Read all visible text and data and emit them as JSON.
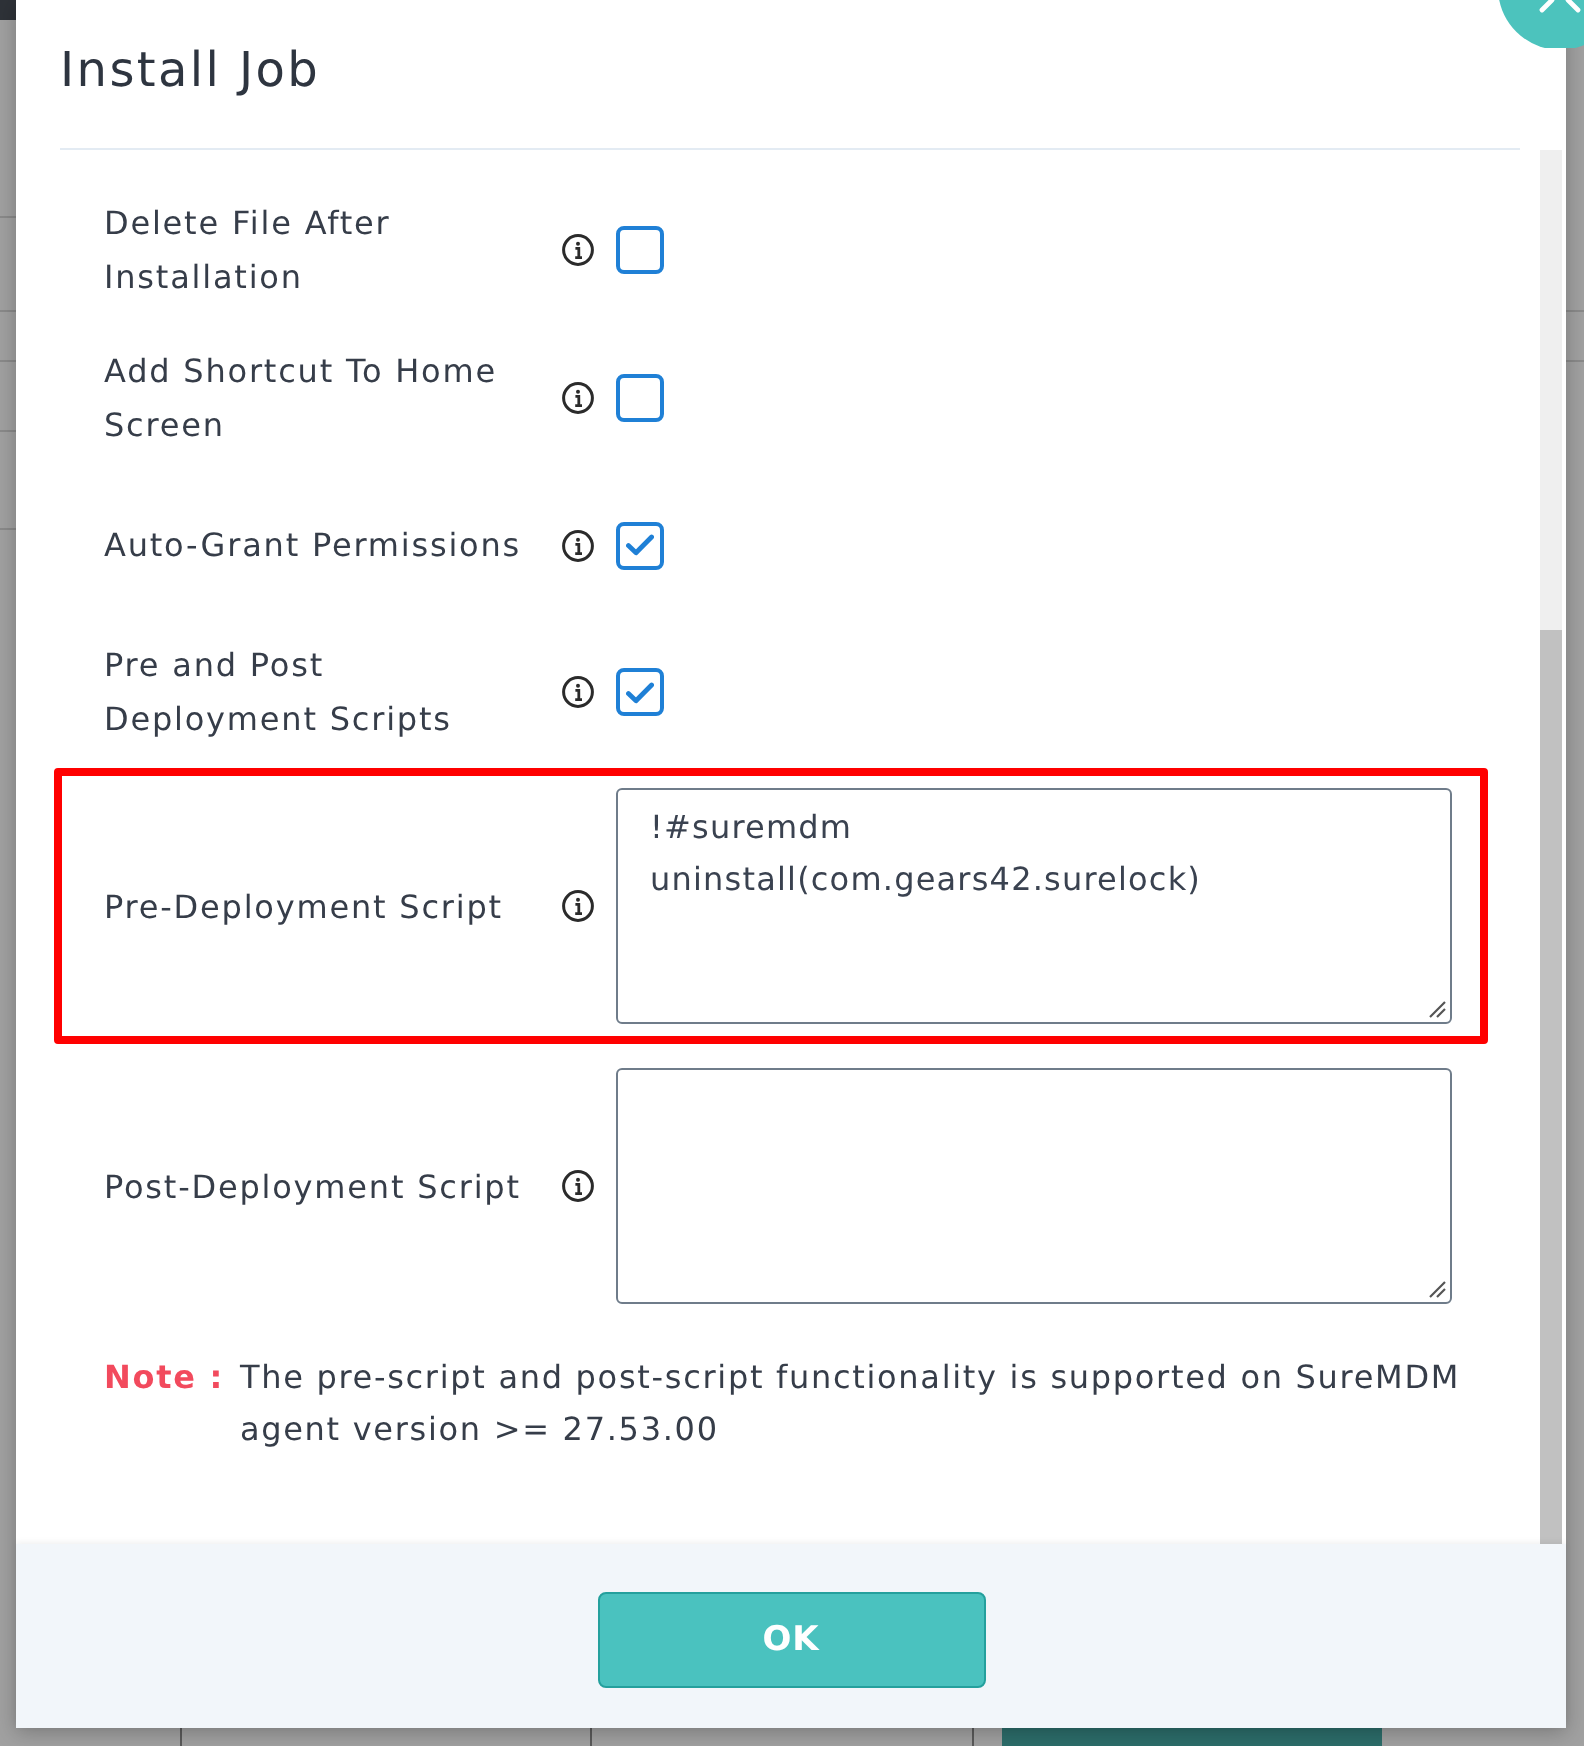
{
  "dialog": {
    "title": "Install Job"
  },
  "options": [
    {
      "kind": "checkbox",
      "label": "Delete File After Installation",
      "checked": false,
      "highlighted": false
    },
    {
      "kind": "checkbox",
      "label": "Add Shortcut To Home Screen",
      "checked": false,
      "highlighted": false
    },
    {
      "kind": "checkbox",
      "label": "Auto-Grant Permissions",
      "checked": true,
      "highlighted": false
    },
    {
      "kind": "checkbox",
      "label": "Pre and Post Deployment Scripts",
      "checked": true,
      "highlighted": false
    },
    {
      "kind": "script",
      "label": "Pre-Deployment Script",
      "value": "!#suremdm\nuninstall(com.gears42.surelock)",
      "highlighted": true
    },
    {
      "kind": "script",
      "label": "Post-Deployment Script",
      "highlighted": false
    }
  ],
  "note": {
    "label": "Note :",
    "text": "The pre-script and post-script functionality is supported on SureMDM agent version >= 27.53.00"
  },
  "footer": {
    "buttons": [
      "OK"
    ]
  }
}
